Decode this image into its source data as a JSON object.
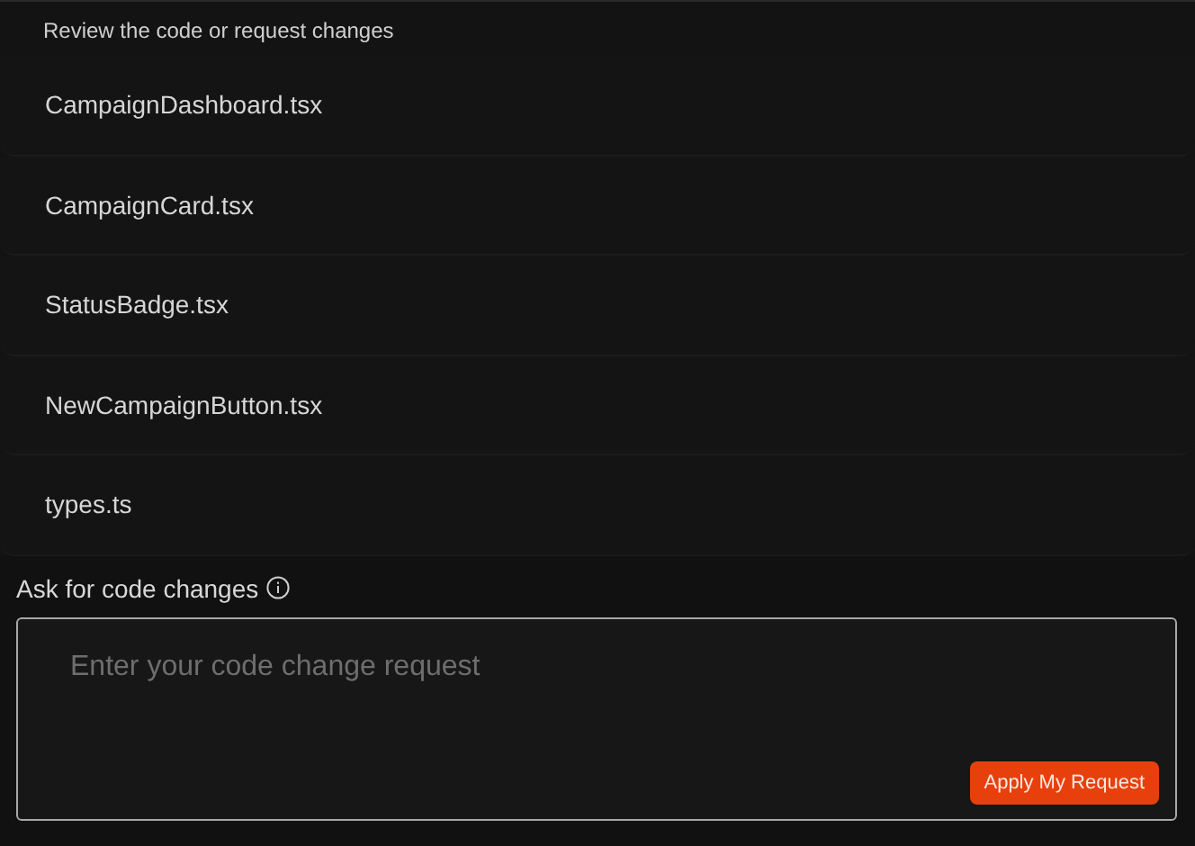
{
  "review": {
    "subtitle": "Review the code or request changes",
    "files": [
      {
        "name": "CampaignDashboard.tsx"
      },
      {
        "name": "CampaignCard.tsx"
      },
      {
        "name": "StatusBadge.tsx"
      },
      {
        "name": "NewCampaignButton.tsx"
      },
      {
        "name": "types.ts"
      }
    ]
  },
  "request": {
    "label": "Ask for code changes",
    "placeholder": "Enter your code change request",
    "button": "Apply My Request"
  }
}
